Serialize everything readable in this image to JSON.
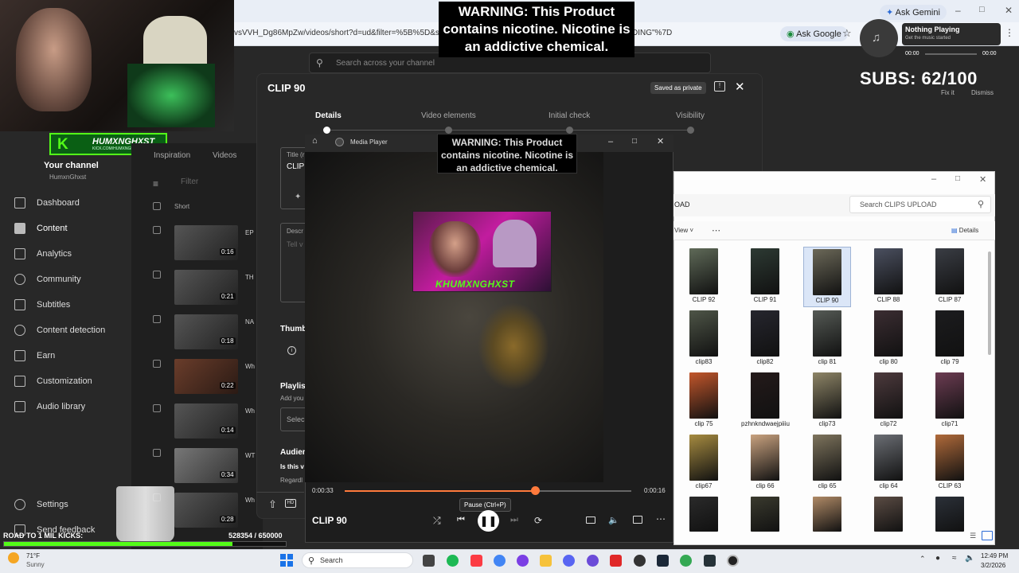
{
  "browser": {
    "url_text": "vsVVH_Dg86MpZw/videos/short?d=ud&filter=%5B%5D&sort",
    "url_tail": "DING\"%7D",
    "ask_gemini": "Ask Gemini",
    "ask_google": "Ask Google"
  },
  "stream_overlay": {
    "warning": "WARNING: This Product contains nicotine. Nicotine is an addictive chemical.",
    "subs": "SUBS: 62/100",
    "road_label": "ROAD TO 1 MIL KICKS:",
    "road_value": "528354 / 650000",
    "road_progress": 0.81,
    "kick_banner": "HUMXNGHXST",
    "kick_url": "KICK.COM/HUMXNGHXST",
    "inner_cam_text": "KHUMXNGHXST"
  },
  "now_playing": {
    "title": "Nothing Playing",
    "subtitle": "Get the music started",
    "time_start": "00:00",
    "time_end": "00:00",
    "fix_it": "Fix it",
    "dismiss": "Dismiss"
  },
  "studio": {
    "search_placeholder": "Search across your channel",
    "channel_label": "Your channel",
    "channel_handle": "HumxnGhxst",
    "nav": [
      "Dashboard",
      "Content",
      "Analytics",
      "Community",
      "Subtitles",
      "Content detection",
      "Earn",
      "Customization",
      "Audio library"
    ],
    "settings": "Settings",
    "send_feedback": "Send feedback",
    "tabs": [
      "Inspiration",
      "Videos"
    ],
    "filter_placeholder": "Filter",
    "column_short": "Short",
    "row_durations": [
      "0:16",
      "0:21",
      "0:18",
      "0:22",
      "0:14",
      "0:34",
      "0:28"
    ],
    "row_titles": [
      "EP",
      "TH",
      "NA",
      "Wh",
      "Wh",
      "WT",
      "Wh"
    ]
  },
  "editor": {
    "title": "CLIP 90",
    "saved_status": "Saved as private",
    "steps": [
      "Details",
      "Video elements",
      "Initial check",
      "Visibility"
    ],
    "title_field_label": "Title (r",
    "title_field_value": "CLIP",
    "description_label": "Descr",
    "description_placeholder": "Tell v",
    "thumbnail_label": "Thumb",
    "playlists_label": "Playlis",
    "playlists_sub": "Add you",
    "select_label": "Selec",
    "audience_label": "Audien",
    "audience_q": "Is this v",
    "audience_sub": "Regardl"
  },
  "media_player": {
    "app_title": "Media Player",
    "track_title": "CLIP 90",
    "time_current": "0:00:33",
    "time_remaining": "0:00:16",
    "progress": 0.665,
    "pause_tooltip": "Pause (Ctrl+P)"
  },
  "explorer": {
    "search_placeholder": "Search CLIPS UPLOAD",
    "location": "OAD",
    "view_label": "View",
    "details_label": "Details",
    "files": [
      {
        "name": "CLIP 92",
        "color": "#5f6a58"
      },
      {
        "name": "CLIP 91",
        "color": "#2d3a33"
      },
      {
        "name": "CLIP 90",
        "color": "#6b6858",
        "selected": true
      },
      {
        "name": "CLIP 88",
        "color": "#4b5060"
      },
      {
        "name": "CLIP 87",
        "color": "#3a3d44"
      },
      {
        "name": "clip83",
        "color": "#4e5547"
      },
      {
        "name": "clip82",
        "color": "#26262e"
      },
      {
        "name": "clip 81",
        "color": "#555a55"
      },
      {
        "name": "clip 80",
        "color": "#3b2d32"
      },
      {
        "name": "clip 79",
        "color": "#1c1c1e"
      },
      {
        "name": "clip 75",
        "color": "#c2562b"
      },
      {
        "name": "pzhnkndwaejpiiiu",
        "color": "#241a1a"
      },
      {
        "name": "clip73",
        "color": "#8e8567"
      },
      {
        "name": "clip72",
        "color": "#4d3a3d"
      },
      {
        "name": "clip71",
        "color": "#6c3c52"
      },
      {
        "name": "clip67",
        "color": "#a68b40"
      },
      {
        "name": "clip 66",
        "color": "#c9a27f"
      },
      {
        "name": "clip 65",
        "color": "#7e745d"
      },
      {
        "name": "clip 64",
        "color": "#6b6e74"
      },
      {
        "name": "CLIP 63",
        "color": "#b06a3a"
      },
      {
        "name": "",
        "color": "#2a2a2a"
      },
      {
        "name": "",
        "color": "#3a3a2e"
      },
      {
        "name": "",
        "color": "#b08a66"
      },
      {
        "name": "",
        "color": "#5b4c44"
      },
      {
        "name": "",
        "color": "#2b3038"
      }
    ]
  },
  "taskbar": {
    "weather_temp": "71°F",
    "weather_desc": "Sunny",
    "search_label": "Search",
    "time": "12:49 PM",
    "date": "3/2/2026"
  }
}
